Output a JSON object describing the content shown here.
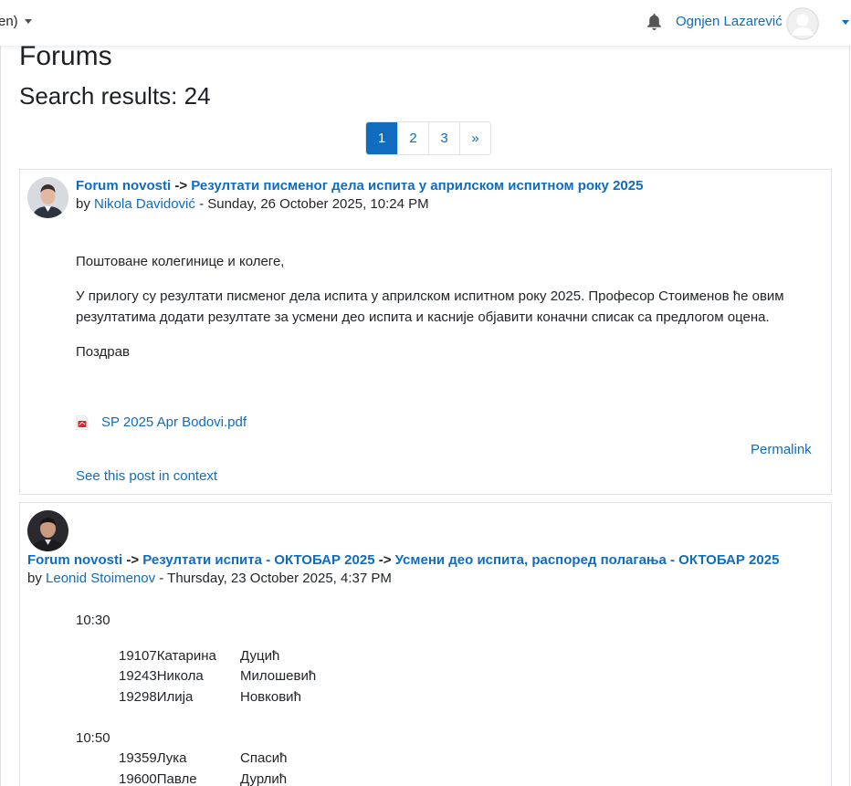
{
  "navbar": {
    "language": "en)",
    "username": "Ognjen Lazarević"
  },
  "page": {
    "title": "Forums",
    "search_results": "Search results: 24"
  },
  "pagination": [
    "1",
    "2",
    "3",
    "»"
  ],
  "posts": [
    {
      "forum": "Forum novosti",
      "sep1": "->",
      "discussion": "Резултати писменог дела испита у априлском испитном року 2025",
      "by": "by",
      "author": "Nikola Davidović",
      "date": "- Sunday, 26 October 2025, 10:24 PM",
      "greeting": "Поштоване колегинице и колеге,",
      "body_line1": "У прилогу су резултати писменог дела испита у априлском испитном року 2025. Професор Стоименов ће овим",
      "body_line2": "резултатима додати резултате за усмени део испита и касније објавити коначни списак са предлогом оцена.",
      "closing": "Поздрав",
      "attachment": "SP 2025 Apr Bodovi.pdf",
      "permalink": "Permalink",
      "context": "See this post in context"
    },
    {
      "forum": "Forum novosti",
      "sep1": "->",
      "discussion": "Резултати испита - ОКТОБАР 2025",
      "sep2": "->",
      "subject": "Усмени део испита, распоред полагања - ОКТОБАР 2025",
      "by": "by",
      "author": "Leonid Stoimenov",
      "date": "- Thursday, 23 October 2025, 4:37 PM",
      "slots": [
        {
          "time": "10:30",
          "students": [
            {
              "id_name": "19107Катарина",
              "surname": "Дуцић"
            },
            {
              "id_name": "19243Никола",
              "surname": "Милошевић"
            },
            {
              "id_name": "19298Илија",
              "surname": "Новковић"
            }
          ]
        },
        {
          "time": "10:50",
          "students": [
            {
              "id_name": "19359Лука",
              "surname": "Спасић"
            },
            {
              "id_name": "19600Павле",
              "surname": "Дурлић"
            }
          ]
        }
      ]
    }
  ]
}
